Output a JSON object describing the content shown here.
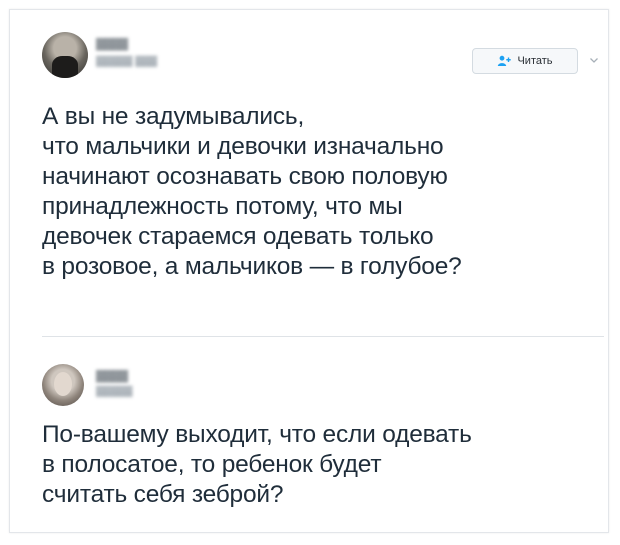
{
  "tweet1": {
    "display_name": "▓▓▓▓",
    "handle": "▓▓▓▓▓ ▓▓▓",
    "follow_label": "Читать",
    "lines": [
      "А вы не задумывались,",
      "что мальчики и девочки изначально",
      "начинают осознавать свою половую",
      "принадлежность потому, что мы",
      "девочек стараемся одевать только",
      "в розовое, а мальчиков — в голубое?"
    ]
  },
  "tweet2": {
    "display_name": "▓▓▓▓",
    "handle": "▓▓▓▓▓",
    "lines": [
      "По-вашему выходит, что если одевать",
      "в полосатое, то ребенок будет",
      "считать себя зеброй?"
    ]
  },
  "icons": {
    "follow": "add-user-icon",
    "caret": "chevron-down-icon"
  },
  "colors": {
    "accent": "#1da1f2",
    "text": "#1f2d3a",
    "muted": "#9aa3ab"
  }
}
